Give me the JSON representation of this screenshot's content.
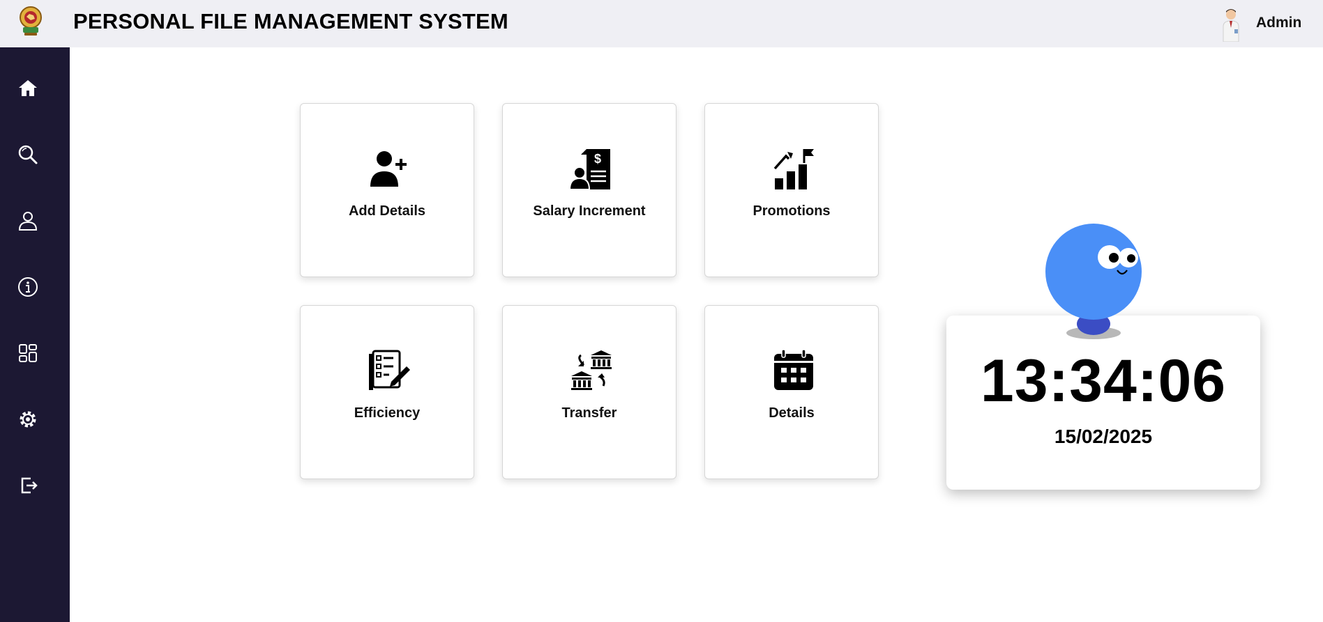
{
  "header": {
    "title": "PERSONAL FILE MANAGEMENT SYSTEM",
    "user_name": "Admin"
  },
  "sidebar": {
    "items": [
      {
        "icon": "home-icon"
      },
      {
        "icon": "search-icon"
      },
      {
        "icon": "user-icon"
      },
      {
        "icon": "info-icon"
      },
      {
        "icon": "dashboard-icon"
      },
      {
        "icon": "settings-icon"
      },
      {
        "icon": "logout-icon"
      }
    ]
  },
  "tiles": [
    {
      "label": "Add Details",
      "icon": "add-user-icon"
    },
    {
      "label": "Salary Increment",
      "icon": "salary-document-icon"
    },
    {
      "label": "Promotions",
      "icon": "growth-chart-icon"
    },
    {
      "label": "Efficiency",
      "icon": "checklist-icon"
    },
    {
      "label": "Transfer",
      "icon": "bank-transfer-icon"
    },
    {
      "label": "Details",
      "icon": "calendar-icon"
    }
  ],
  "clock": {
    "time": "13:34:06",
    "date": "15/02/2025"
  },
  "colors": {
    "sidebar_bg": "#1c1833",
    "topbar_bg": "#efeff4",
    "mascot_blue": "#4a8ff7"
  }
}
